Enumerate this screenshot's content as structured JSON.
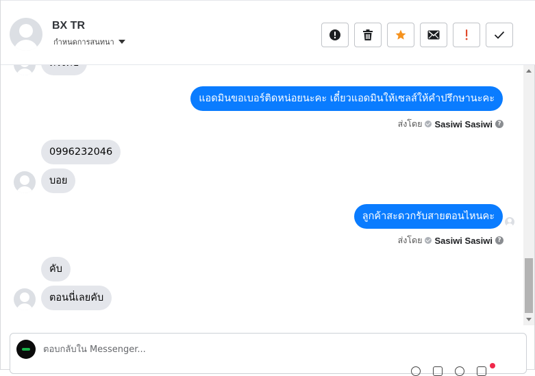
{
  "header": {
    "contact_name": "BX TR",
    "assign_label": "กำหนดการสนทนา"
  },
  "actions": [
    {
      "name": "spam-button",
      "icon": "exclamation-circle-icon"
    },
    {
      "name": "delete-button",
      "icon": "trash-icon"
    },
    {
      "name": "star-button",
      "icon": "star-icon",
      "color": "#f5921e"
    },
    {
      "name": "mark-unread-button",
      "icon": "envelope-icon"
    },
    {
      "name": "follow-up-button",
      "icon": "exclamation-icon",
      "color": "#e0492b"
    },
    {
      "name": "done-button",
      "icon": "check-icon"
    }
  ],
  "messages": [
    {
      "direction": "in",
      "text": "ตรงคับ"
    },
    {
      "direction": "out",
      "text": "แอดมินขอเบอร์ติดหน่อยนะคะ เดี๋ยวแอดมินให้เซลส์ให้คำปรึกษานะคะ"
    },
    {
      "direction": "in",
      "text": "0996232046"
    },
    {
      "direction": "in",
      "text": "บอย"
    },
    {
      "direction": "out",
      "text": "ลูกค้าสะดวกรับสายตอนไหนคะ"
    },
    {
      "direction": "in",
      "text": "คับ"
    },
    {
      "direction": "in",
      "text": "ตอนนี่เลยคับ"
    }
  ],
  "sent_by": {
    "prefix": "ส่งโดย",
    "agent": "Sasiwi Sasiwi",
    "help": "?"
  },
  "composer": {
    "placeholder": "ตอบกลับใน Messenger..."
  },
  "colors": {
    "outgoing_bubble": "#0a7cff",
    "incoming_bubble": "#e4e6eb"
  }
}
